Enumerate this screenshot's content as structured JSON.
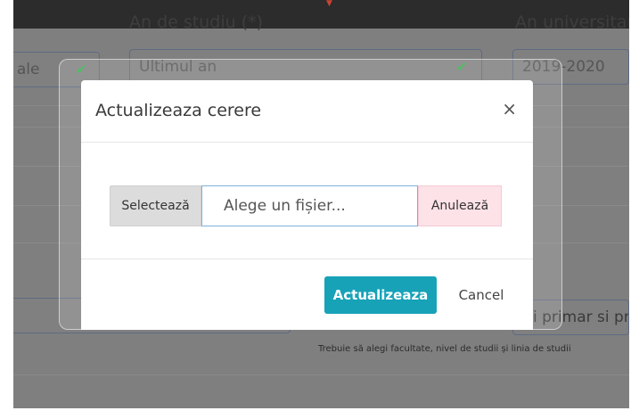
{
  "background": {
    "label_study_year": "An de studiu (*)",
    "label_academic_year": "An universitar",
    "field_left_partial": "e ale",
    "field_study_year": "Ultimul an",
    "field_academic_year": "2019-2020",
    "field_right_partial": "i primar si pr",
    "note": "Trebuie să alegi facultate, nivel de studii și linia de studii"
  },
  "modal": {
    "title": "Actualizeaza cerere",
    "close_symbol": "×",
    "select_label": "Selectează",
    "file_placeholder": "Alege un fișier...",
    "clear_label": "Anulează",
    "submit_label": "Actualizeaza",
    "cancel_label": "Cancel"
  },
  "colors": {
    "primary": "#17a2b8",
    "success_check": "#37b24d"
  },
  "icons": {
    "close": "close-icon",
    "check": "check-icon"
  }
}
